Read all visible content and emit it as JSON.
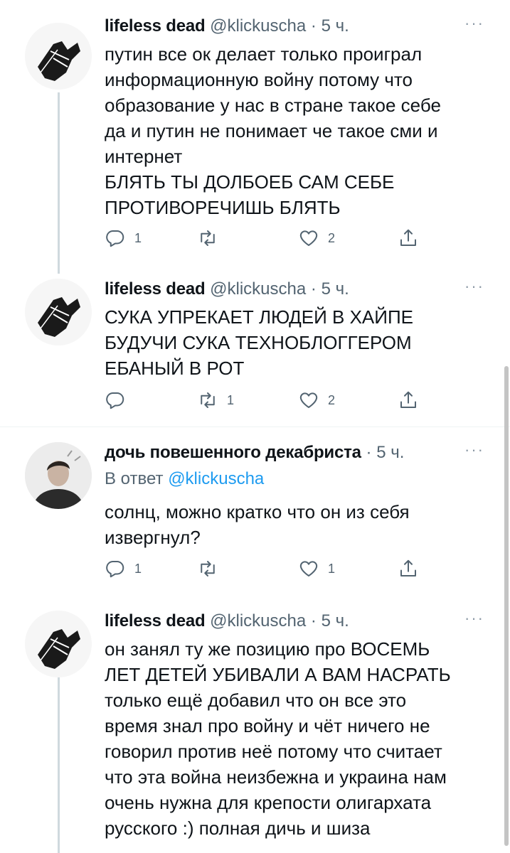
{
  "tweets": [
    {
      "name": "lifeless dead",
      "handle": "@klickuscha",
      "sep": "·",
      "time": "5 ч.",
      "more": "···",
      "lines": [
        "путин все ок делает только проиграл",
        "информационную войну потому что",
        "образование у нас в стране такое себе",
        "да и путин не понимает че такое сми и",
        "интернет",
        "БЛЯТЬ ТЫ ДОЛБОЕБ САМ СЕБЕ",
        "ПРОТИВОРЕЧИШЬ БЛЯТЬ"
      ],
      "replies": "1",
      "retweets": "",
      "likes": "2"
    },
    {
      "name": "lifeless dead",
      "handle": "@klickuscha",
      "sep": "·",
      "time": "5 ч.",
      "more": "···",
      "lines": [
        "СУКА УПРЕКАЕТ ЛЮДЕЙ В ХАЙПЕ",
        "БУДУЧИ СУКА ТЕХНОБЛОГГЕРОМ",
        "ЕБАНЫЙ В РОТ"
      ],
      "replies": "",
      "retweets": "1",
      "likes": "2"
    },
    {
      "name": "дочь повешенного декабриста",
      "handle": "",
      "sep": "·",
      "time": "5 ч.",
      "more": "···",
      "reply_prefix": "В ответ",
      "reply_mention": "@klickuscha",
      "lines": [
        "солнц, можно кратко что он из себя",
        "извергнул?"
      ],
      "replies": "1",
      "retweets": "",
      "likes": "1"
    },
    {
      "name": "lifeless dead",
      "handle": "@klickuscha",
      "sep": "·",
      "time": "5 ч.",
      "more": "···",
      "lines": [
        "он занял ту же позицию про ВОСЕМЬ",
        "ЛЕТ ДЕТЕЙ УБИВАЛИ А ВАМ НАСРАТЬ",
        "только ещё добавил что он все это",
        "время знал про войну и чёт ничего не",
        "говорил против неё потому что считает",
        "что эта война неизбежна и украина нам",
        "очень нужна для крепости олигархата",
        "русского :) полная дичь и шиза"
      ]
    }
  ]
}
